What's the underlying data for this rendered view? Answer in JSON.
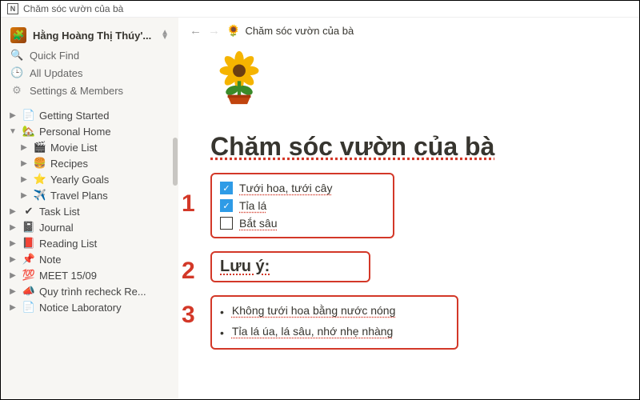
{
  "window": {
    "title": "Chăm sóc vườn của bà"
  },
  "workspace": {
    "name": "Hằng Hoàng Thị Thúy'..."
  },
  "nav": {
    "quick_find": "Quick Find",
    "all_updates": "All Updates",
    "settings": "Settings & Members"
  },
  "tree": [
    {
      "icon": "📄",
      "label": "Getting Started",
      "expanded": false,
      "depth": 0
    },
    {
      "icon": "🏡",
      "label": "Personal Home",
      "expanded": true,
      "depth": 0
    },
    {
      "icon": "🎬",
      "label": "Movie List",
      "expanded": false,
      "depth": 1
    },
    {
      "icon": "🍔",
      "label": "Recipes",
      "expanded": false,
      "depth": 1
    },
    {
      "icon": "⭐",
      "label": "Yearly Goals",
      "expanded": false,
      "depth": 1
    },
    {
      "icon": "✈️",
      "label": "Travel Plans",
      "expanded": false,
      "depth": 1
    },
    {
      "icon": "✔",
      "label": "Task List",
      "expanded": false,
      "depth": 0
    },
    {
      "icon": "📓",
      "label": "Journal",
      "expanded": false,
      "depth": 0
    },
    {
      "icon": "📕",
      "label": "Reading List",
      "expanded": false,
      "depth": 0
    },
    {
      "icon": "📌",
      "label": "Note",
      "expanded": false,
      "depth": 0
    },
    {
      "icon": "💯",
      "label": "MEET 15/09",
      "expanded": false,
      "depth": 0
    },
    {
      "icon": "📣",
      "label": "Quy trình recheck Re...",
      "expanded": false,
      "depth": 0
    },
    {
      "icon": "📄",
      "label": "Notice Laboratory",
      "expanded": false,
      "depth": 0
    }
  ],
  "breadcrumb": {
    "icon": "🌻",
    "title": "Chăm sóc vườn của bà"
  },
  "page": {
    "icon": "🌻",
    "title": "Chăm sóc vườn của bà",
    "todos": [
      {
        "checked": true,
        "text": "Tưới hoa, tưới cây"
      },
      {
        "checked": true,
        "text": "Tỉa lá"
      },
      {
        "checked": false,
        "text": "Bắt sâu"
      }
    ],
    "heading": "Lưu ý:",
    "bullets": [
      "Không tưới hoa bằng nước nóng",
      "Tỉa lá úa, lá sâu, nhớ nhẹ nhàng"
    ]
  },
  "annotations": {
    "n1": "1",
    "n2": "2",
    "n3": "3"
  }
}
